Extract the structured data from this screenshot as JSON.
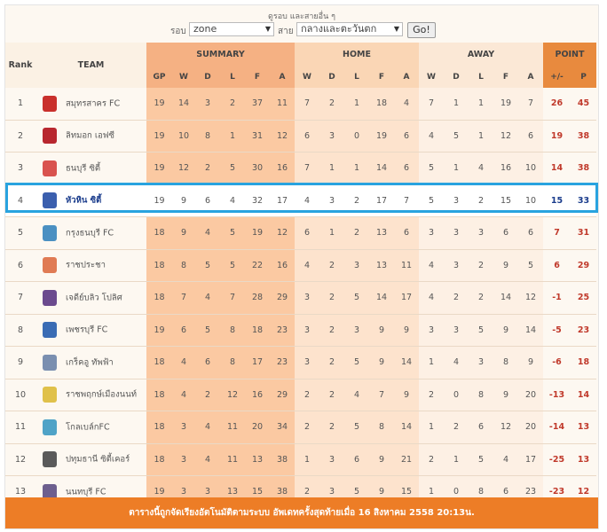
{
  "filter": {
    "caption": "ดูรอบ และสายอื่น ๆ",
    "round_label": "รอบ",
    "round_value": "zone",
    "group_label": "สาย",
    "group_value": "กลางและตะวันตก",
    "go_label": "Go!"
  },
  "headers": {
    "rank": "Rank",
    "team": "TEAM",
    "summary": "SUMMARY",
    "home": "HOME",
    "away": "AWAY",
    "point": "POINT",
    "gp": "GP",
    "w": "W",
    "d": "D",
    "l": "L",
    "f": "F",
    "a": "A",
    "gd": "+/-",
    "p": "P"
  },
  "rows": [
    {
      "rank": "1",
      "team": "สมุทรสาคร FC",
      "logo": "#c9302c",
      "s": [
        "19",
        "14",
        "3",
        "2",
        "37",
        "11"
      ],
      "h": [
        "7",
        "2",
        "1",
        "18",
        "4"
      ],
      "a": [
        "7",
        "1",
        "1",
        "19",
        "7"
      ],
      "gd": "26",
      "p": "45"
    },
    {
      "rank": "2",
      "team": "ลิทมอก เอฟซี",
      "logo": "#b8272f",
      "s": [
        "19",
        "10",
        "8",
        "1",
        "31",
        "12"
      ],
      "h": [
        "6",
        "3",
        "0",
        "19",
        "6"
      ],
      "a": [
        "4",
        "5",
        "1",
        "12",
        "6"
      ],
      "gd": "19",
      "p": "38"
    },
    {
      "rank": "3",
      "team": "ธนบุรี ซิตี้",
      "logo": "#d9534f",
      "s": [
        "19",
        "12",
        "2",
        "5",
        "30",
        "16"
      ],
      "h": [
        "7",
        "1",
        "1",
        "14",
        "6"
      ],
      "a": [
        "5",
        "1",
        "4",
        "16",
        "10"
      ],
      "gd": "14",
      "p": "38"
    },
    {
      "rank": "4",
      "team": "หัวหิน ซิตี้",
      "logo": "#3b5fae",
      "s": [
        "19",
        "9",
        "6",
        "4",
        "32",
        "17"
      ],
      "h": [
        "4",
        "3",
        "2",
        "17",
        "7"
      ],
      "a": [
        "5",
        "3",
        "2",
        "15",
        "10"
      ],
      "gd": "15",
      "p": "33"
    },
    {
      "rank": "5",
      "team": "กรุงธนบุรี FC",
      "logo": "#4a90c2",
      "s": [
        "18",
        "9",
        "4",
        "5",
        "19",
        "12"
      ],
      "h": [
        "6",
        "1",
        "2",
        "13",
        "6"
      ],
      "a": [
        "3",
        "3",
        "3",
        "6",
        "6"
      ],
      "gd": "7",
      "p": "31"
    },
    {
      "rank": "6",
      "team": "ราชประชา",
      "logo": "#e07b54",
      "s": [
        "18",
        "8",
        "5",
        "5",
        "22",
        "16"
      ],
      "h": [
        "4",
        "2",
        "3",
        "13",
        "11"
      ],
      "a": [
        "4",
        "3",
        "2",
        "9",
        "5"
      ],
      "gd": "6",
      "p": "29"
    },
    {
      "rank": "7",
      "team": "เจดีย์บลิว โปลิศ",
      "logo": "#6b4a8e",
      "s": [
        "18",
        "7",
        "4",
        "7",
        "28",
        "29"
      ],
      "h": [
        "3",
        "2",
        "5",
        "14",
        "17"
      ],
      "a": [
        "4",
        "2",
        "2",
        "14",
        "12"
      ],
      "gd": "-1",
      "p": "25"
    },
    {
      "rank": "8",
      "team": "เพชรบุรี FC",
      "logo": "#3a6cb4",
      "s": [
        "19",
        "6",
        "5",
        "8",
        "18",
        "23"
      ],
      "h": [
        "3",
        "2",
        "3",
        "9",
        "9"
      ],
      "a": [
        "3",
        "3",
        "5",
        "9",
        "14"
      ],
      "gd": "-5",
      "p": "23"
    },
    {
      "rank": "9",
      "team": "เกร็คอู ทัพฟ้า",
      "logo": "#7a8fb0",
      "s": [
        "18",
        "4",
        "6",
        "8",
        "17",
        "23"
      ],
      "h": [
        "3",
        "2",
        "5",
        "9",
        "14"
      ],
      "a": [
        "1",
        "4",
        "3",
        "8",
        "9"
      ],
      "gd": "-6",
      "p": "18"
    },
    {
      "rank": "10",
      "team": "ราชพฤกษ์เมืองนนท์",
      "logo": "#e0c14a",
      "s": [
        "18",
        "4",
        "2",
        "12",
        "16",
        "29"
      ],
      "h": [
        "2",
        "2",
        "4",
        "7",
        "9"
      ],
      "a": [
        "2",
        "0",
        "8",
        "9",
        "20"
      ],
      "gd": "-13",
      "p": "14"
    },
    {
      "rank": "11",
      "team": "โกลเบล์กFC",
      "logo": "#4fa3c7",
      "s": [
        "18",
        "3",
        "4",
        "11",
        "20",
        "34"
      ],
      "h": [
        "2",
        "2",
        "5",
        "8",
        "14"
      ],
      "a": [
        "1",
        "2",
        "6",
        "12",
        "20"
      ],
      "gd": "-14",
      "p": "13"
    },
    {
      "rank": "12",
      "team": "ปทุมธานี ซิตี้เคอร์",
      "logo": "#5a5a5a",
      "s": [
        "18",
        "3",
        "4",
        "11",
        "13",
        "38"
      ],
      "h": [
        "1",
        "3",
        "6",
        "9",
        "21"
      ],
      "a": [
        "2",
        "1",
        "5",
        "4",
        "17"
      ],
      "gd": "-25",
      "p": "13"
    },
    {
      "rank": "13",
      "team": "นนทบุรี FC",
      "logo": "#6d5f8e",
      "s": [
        "19",
        "3",
        "3",
        "13",
        "15",
        "38"
      ],
      "h": [
        "2",
        "3",
        "5",
        "9",
        "15"
      ],
      "a": [
        "1",
        "0",
        "8",
        "6",
        "23"
      ],
      "gd": "-23",
      "p": "12"
    }
  ],
  "highlight_rank": "4",
  "footer": "ตารางนี้ถูกจัดเรียงอัตโนมัติตามระบบ อัพเดทครั้งสุดท้ายเมื่อ 16 สิงหาคม 2558 20:13น."
}
